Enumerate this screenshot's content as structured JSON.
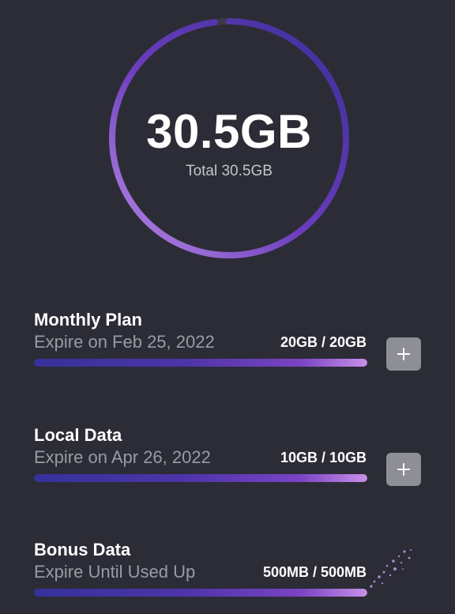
{
  "summary": {
    "amount": "30.5GB",
    "total_label": "Total 30.5GB",
    "remaining_fraction": 0.98,
    "ring_colors": {
      "start": "#b98be6",
      "mid": "#6b3dbd",
      "end": "#3b2f9a"
    }
  },
  "plans": [
    {
      "name": "Monthly Plan",
      "expiry": "Expire on Feb 25, 2022",
      "usage": "20GB / 20GB",
      "fill_fraction": 1.0,
      "has_add_button": true,
      "add_icon": "plus-icon"
    },
    {
      "name": "Local Data",
      "expiry": "Expire on Apr 26, 2022",
      "usage": "10GB / 10GB",
      "fill_fraction": 1.0,
      "has_add_button": true,
      "add_icon": "plus-icon"
    },
    {
      "name": "Bonus Data",
      "expiry": "Expire Until Used Up",
      "usage": "500MB / 500MB",
      "fill_fraction": 1.0,
      "has_add_button": false
    }
  ],
  "colors": {
    "background": "#2c2c37",
    "bar_gradient_start": "#35329a",
    "bar_gradient_end": "#c890e8",
    "button_bg": "#8e8e96"
  }
}
